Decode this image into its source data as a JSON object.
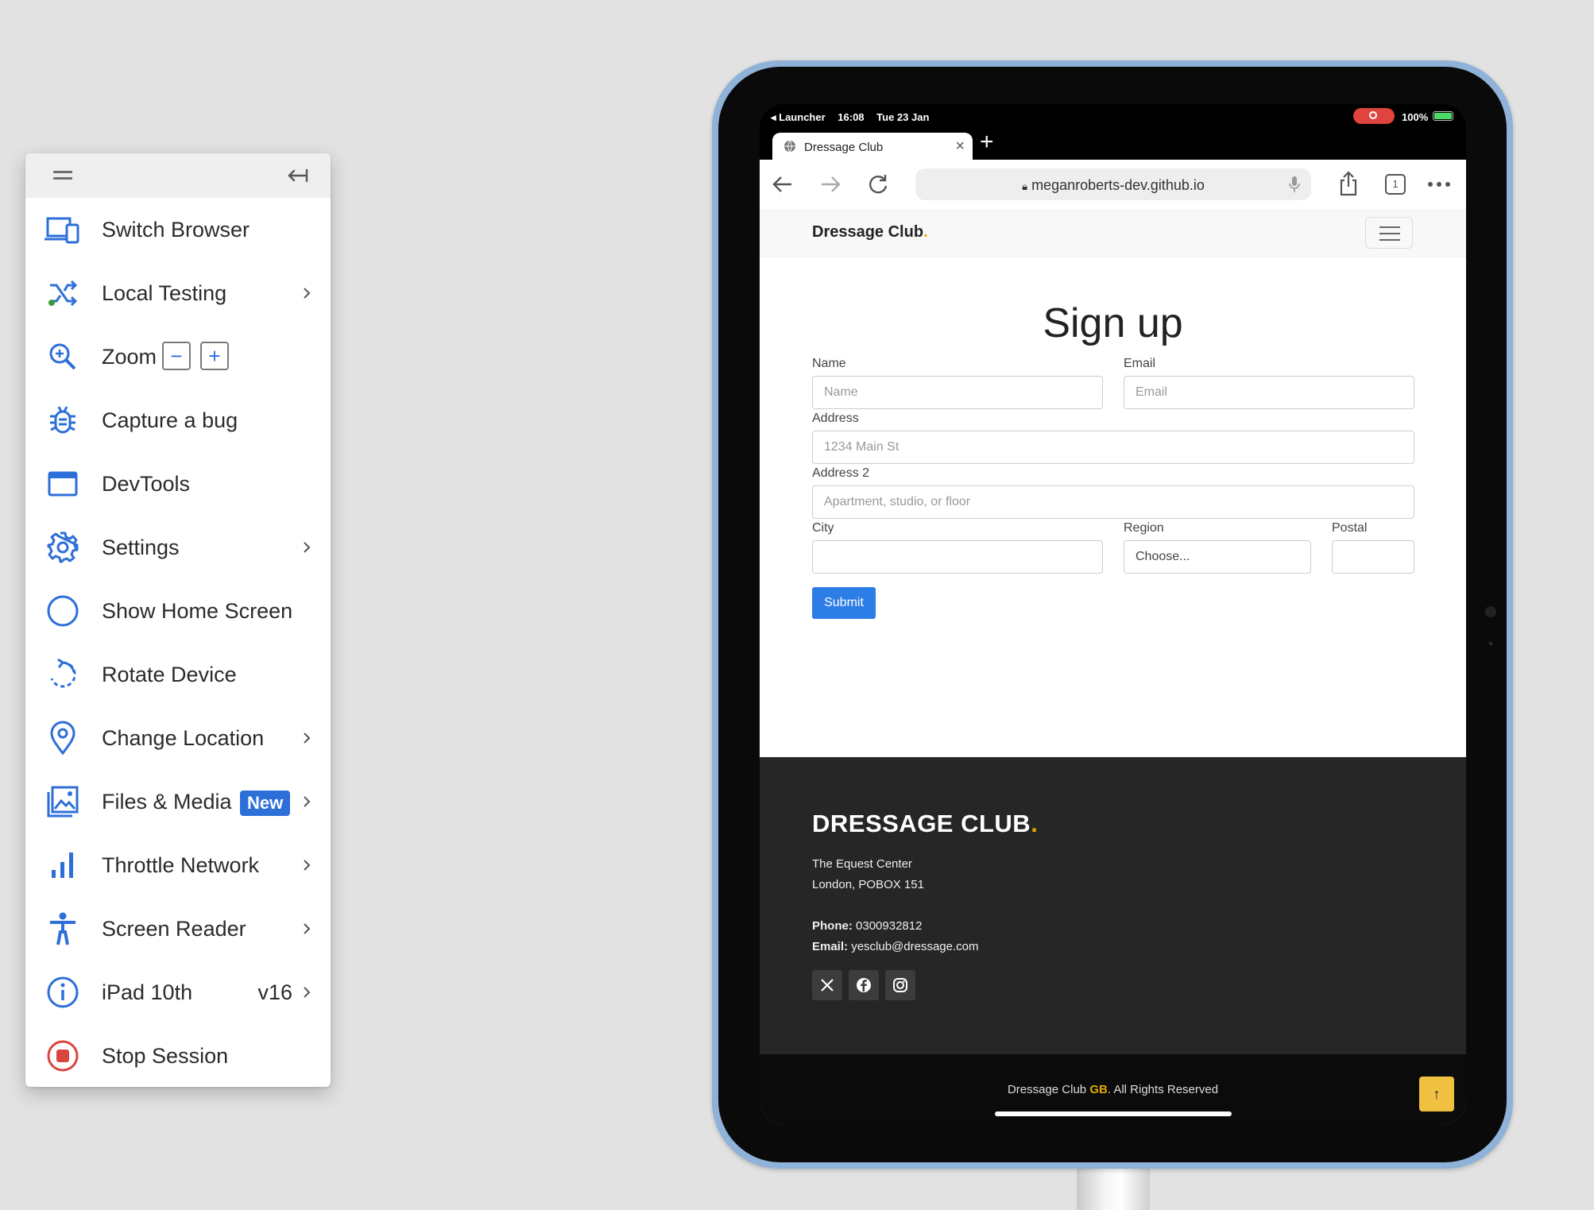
{
  "panel": {
    "items": [
      {
        "label": "Switch Browser",
        "icon": "switch-browser-icon"
      },
      {
        "label": "Local Testing",
        "icon": "local-testing-icon",
        "chevron": true
      },
      {
        "label": "Zoom",
        "icon": "zoom-icon",
        "zoom_out": "−",
        "zoom_in": "+"
      },
      {
        "label": "Capture a bug",
        "icon": "bug-icon"
      },
      {
        "label": "DevTools",
        "icon": "devtools-icon"
      },
      {
        "label": "Settings",
        "icon": "gear-icon",
        "chevron": true
      },
      {
        "label": "Show Home Screen",
        "icon": "home-circle-icon"
      },
      {
        "label": "Rotate Device",
        "icon": "rotate-icon"
      },
      {
        "label": "Change Location",
        "icon": "location-pin-icon",
        "chevron": true
      },
      {
        "label": "Files & Media",
        "icon": "image-icon",
        "badge": "New",
        "chevron": true
      },
      {
        "label": "Throttle Network",
        "icon": "signal-bars-icon",
        "chevron": true
      },
      {
        "label": "Screen Reader",
        "icon": "accessibility-icon",
        "chevron": true
      },
      {
        "label": "iPad 10th",
        "icon": "info-icon",
        "version": "v16",
        "chevron": true
      },
      {
        "label": "Stop Session",
        "icon": "stop-icon"
      }
    ],
    "accent_color": "#2d6fd9",
    "stop_color": "#d9463e"
  },
  "device": {
    "status": {
      "app": "◂ Launcher",
      "time": "16:08",
      "date": "Tue 23 Jan",
      "battery": "100%"
    },
    "tab_title": "Dressage Club",
    "new_tab": "+",
    "tab_close": "×",
    "url": "meganroberts-dev.github.io",
    "tab_count": "1"
  },
  "site": {
    "brand": "Dressage Club",
    "brand_dot": ".",
    "heading": "Sign up",
    "form": {
      "name_label": "Name",
      "name_placeholder": "Name",
      "email_label": "Email",
      "email_placeholder": "Email",
      "address_label": "Address",
      "address_placeholder": "1234 Main St",
      "address2_label": "Address 2",
      "address2_placeholder": "Apartment, studio, or floor",
      "city_label": "City",
      "city_value": "",
      "region_label": "Region",
      "region_value": "Choose...",
      "postal_label": "Postal",
      "postal_value": "",
      "submit": "Submit"
    },
    "footer": {
      "brand": "DRESSAGE CLUB",
      "brand_dot": ".",
      "address_line1": "The Equest Center",
      "address_line2": "London, POBOX 151",
      "phone_label": "Phone:",
      "phone": "0300932812",
      "email_label": "Email:",
      "email": "yesclub@dressage.com",
      "copyright_pre": "Dressage Club",
      "copyright_gb": "GB",
      "copyright_post": ". All Rights Reserved",
      "to_top": "↑"
    },
    "accent": "#e0a800",
    "button_color": "#2d7de6"
  }
}
